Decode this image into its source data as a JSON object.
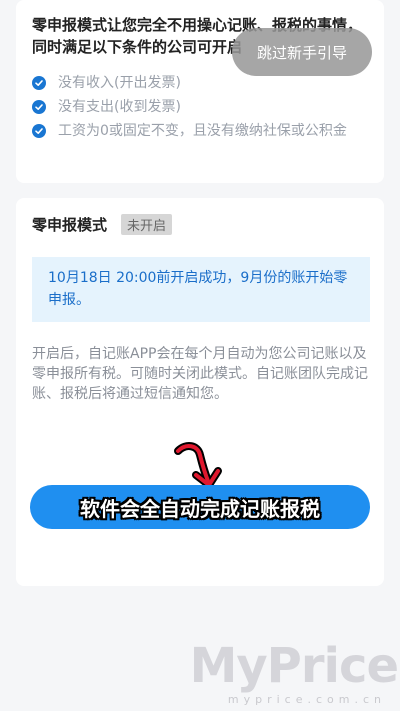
{
  "intro": {
    "title": "零申报模式让您完全不用操心记账、报税的事情，同时满足以下条件的公司可开启",
    "conditions": [
      "没有收入(开出发票)",
      "没有支出(收到发票)",
      "工资为0或固定不变，且没有缴纳社保或公积金"
    ]
  },
  "mode": {
    "title": "零申报模式",
    "status": "未开启",
    "notice": "10月18日 20:00前开启成功，9月份的账开始零申报。",
    "description": "开启后，自记账APP会在每个月自动为您公司记账以及零申报所有税。可随时关闭此模式。自记账团队完成记账、报税后将通过短信通知您。",
    "action_label": "软件会全自动完成记账报税"
  },
  "guide": {
    "skip_label": "跳过新手引导"
  },
  "watermark": {
    "brand": "MyPrice",
    "site": "myprice.com.cn"
  },
  "colors": {
    "accent": "#1976d2",
    "notice_bg": "#e5f3fd",
    "button": "#1f8ff0"
  }
}
